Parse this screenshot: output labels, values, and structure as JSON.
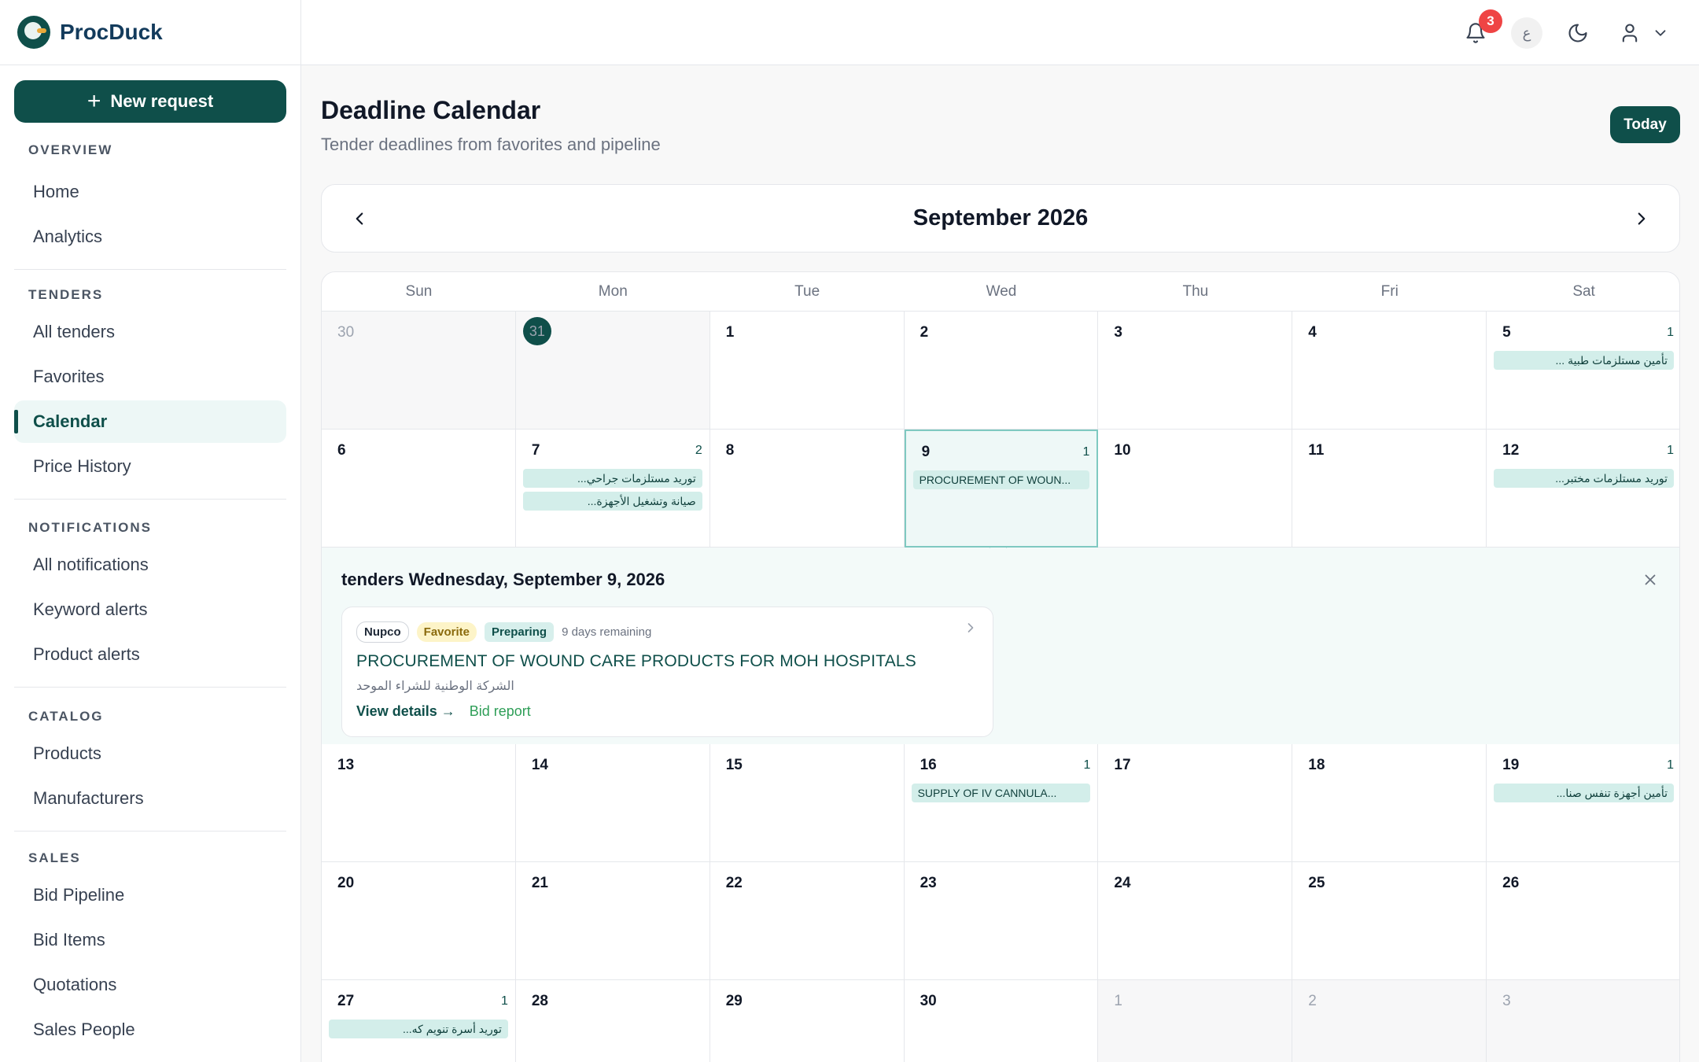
{
  "app": {
    "name": "ProcDuck"
  },
  "sidebar": {
    "new_request_label": "New request",
    "sections": [
      {
        "title": "OVERVIEW",
        "items": [
          "Home",
          "Analytics"
        ]
      },
      {
        "title": "TENDERS",
        "items": [
          "All tenders",
          "Favorites",
          "Calendar",
          "Price History"
        ]
      },
      {
        "title": "NOTIFICATIONS",
        "items": [
          "All notifications",
          "Keyword alerts",
          "Product alerts"
        ]
      },
      {
        "title": "CATALOG",
        "items": [
          "Products",
          "Manufacturers"
        ]
      },
      {
        "title": "SALES",
        "items": [
          "Bid Pipeline",
          "Bid Items",
          "Quotations",
          "Sales People"
        ]
      }
    ],
    "active_item": "Calendar"
  },
  "topbar": {
    "notification_count": "3",
    "language_label": "ع",
    "icons": [
      "bell-icon",
      "moon-icon",
      "user-icon",
      "chevron-down-icon"
    ]
  },
  "header": {
    "title": "Deadline Calendar",
    "subtitle": "Tender deadlines from favorites and pipeline",
    "today_label": "Today"
  },
  "calendar": {
    "month_label": "September 2026",
    "weekdays": [
      "Sun",
      "Mon",
      "Tue",
      "Wed",
      "Thu",
      "Fri",
      "Sat"
    ],
    "weeks": [
      [
        {
          "day": "30",
          "outside": true
        },
        {
          "day": "31",
          "outside": true,
          "today": true
        },
        {
          "day": "1"
        },
        {
          "day": "2"
        },
        {
          "day": "3"
        },
        {
          "day": "4"
        },
        {
          "day": "5",
          "count": "1",
          "events": [
            {
              "text": "تأمين مستلزمات طبية ...",
              "rtl": true
            }
          ]
        }
      ],
      [
        {
          "day": "6"
        },
        {
          "day": "7",
          "count": "2",
          "events": [
            {
              "text": "توريد مستلزمات جراحي...",
              "rtl": true
            },
            {
              "text": "صيانة وتشغيل الأجهزة...",
              "rtl": true
            }
          ]
        },
        {
          "day": "8"
        },
        {
          "day": "9",
          "count": "1",
          "selected": true,
          "events": [
            {
              "text": "PROCUREMENT OF WOUN...",
              "rtl": false
            }
          ]
        },
        {
          "day": "10"
        },
        {
          "day": "11"
        },
        {
          "day": "12",
          "count": "1",
          "events": [
            {
              "text": "توريد مستلزمات مختبر...",
              "rtl": true
            }
          ]
        }
      ],
      [
        {
          "day": "13"
        },
        {
          "day": "14"
        },
        {
          "day": "15"
        },
        {
          "day": "16",
          "count": "1",
          "events": [
            {
              "text": "SUPPLY OF IV CANNULA...",
              "rtl": false
            }
          ]
        },
        {
          "day": "17"
        },
        {
          "day": "18"
        },
        {
          "day": "19",
          "count": "1",
          "events": [
            {
              "text": "تأمين أجهزة تنفس صنا...",
              "rtl": true
            }
          ]
        }
      ],
      [
        {
          "day": "20"
        },
        {
          "day": "21"
        },
        {
          "day": "22"
        },
        {
          "day": "23"
        },
        {
          "day": "24"
        },
        {
          "day": "25"
        },
        {
          "day": "26"
        }
      ],
      [
        {
          "day": "27",
          "count": "1",
          "events": [
            {
              "text": "توريد أسرة تنويم كه...",
              "rtl": true
            }
          ]
        },
        {
          "day": "28"
        },
        {
          "day": "29"
        },
        {
          "day": "30"
        },
        {
          "day": "1",
          "outside": true
        },
        {
          "day": "2",
          "outside": true
        },
        {
          "day": "3",
          "outside": true
        }
      ]
    ]
  },
  "detail": {
    "title": "tenders Wednesday, September 9, 2026",
    "tender": {
      "source": "Nupco",
      "favorite_label": "Favorite",
      "status": "Preparing",
      "remaining": "9 days remaining",
      "title": "PROCUREMENT OF WOUND CARE PRODUCTS FOR MOH HOSPITALS",
      "organization": "الشركة الوطنية للشراء الموحد",
      "view_details_label": "View details →",
      "bid_report_label": "Bid report"
    }
  },
  "colors": {
    "brand": "#0f4f4a",
    "event_chip": "#d3eeea",
    "badge": "#ef4444",
    "favorite_tag": "#fdf4c8"
  }
}
